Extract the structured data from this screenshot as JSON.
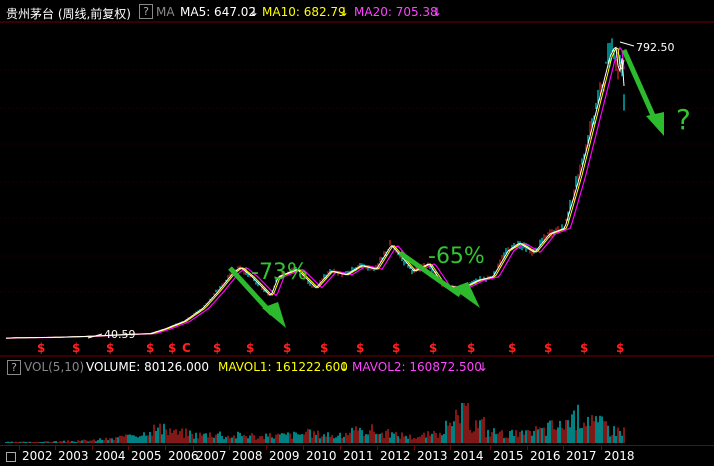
{
  "header": {
    "title": "贵州茅台 (周线,前复权)",
    "help_glyph": "?",
    "ma_label": "MA",
    "ma5": "MA5: 647.02",
    "ma10": "MA10: 682.79",
    "ma20": "MA20: 705.38",
    "arrow_glyph": "↓"
  },
  "annotations": {
    "drop1": "-73%",
    "drop2": "-65%",
    "question": "?",
    "low_price": "40.59",
    "high_price": "792.50"
  },
  "volume_header": {
    "help_glyph": "?",
    "vol_label": "VOL(5,10)",
    "volume": "VOLUME: 80126.000",
    "mavol1": "MAVOL1: 161222.600",
    "mavol2": "MAVOL2: 160872.500",
    "arrow_glyph": "↓"
  },
  "event_markers": [
    "$",
    "$",
    "$",
    "$",
    "$",
    "C",
    "$",
    "$",
    "$",
    "$",
    "$",
    "$",
    "$",
    "$",
    "$",
    "$",
    "$",
    "$"
  ],
  "x_axis": {
    "years": [
      "2002",
      "2003",
      "2004",
      "2005",
      "2006",
      "2007",
      "2008",
      "2009",
      "2010",
      "2011",
      "2012",
      "2013",
      "2014",
      "2015",
      "2016",
      "2017",
      "2018"
    ]
  },
  "colors": {
    "background": "#000000",
    "grid": "#3a0000",
    "ma5": "#ffffff",
    "ma10": "#ffff00",
    "ma20": "#ff00ff",
    "candle_up": "#ff3030",
    "candle_down": "#00ffff",
    "volume_up": "#ff3030",
    "volume_down": "#00ffff",
    "annotation": "#33c433",
    "event_marker": "#ff2020"
  },
  "chart_data": {
    "type": "line",
    "title": "贵州茅台 (周线,前复权)",
    "x": [
      2001.8,
      2002,
      2003,
      2004,
      2005,
      2005.6,
      2006,
      2006.5,
      2007,
      2007.4,
      2007.8,
      2008.0,
      2008.3,
      2008.8,
      2009.0,
      2009.5,
      2010.0,
      2010.4,
      2010.8,
      2011.2,
      2011.6,
      2012.0,
      2012.3,
      2012.6,
      2013.0,
      2013.4,
      2013.9,
      2014.3,
      2014.7,
      2015.1,
      2015.4,
      2015.8,
      2016.2,
      2016.6,
      2017.0,
      2017.4,
      2017.8,
      2017.95,
      2018.05,
      2018.1,
      2018.2
    ],
    "series": [
      {
        "name": "MA5",
        "values": [
          5,
          6,
          7,
          10,
          15,
          17,
          30,
          50,
          85,
          130,
          180,
          195,
          170,
          118,
          170,
          190,
          140,
          185,
          175,
          200,
          190,
          255,
          220,
          185,
          205,
          145,
          140,
          160,
          170,
          240,
          260,
          235,
          285,
          300,
          440,
          600,
          760,
          792.5,
          700,
          780,
          640
        ]
      }
    ],
    "low_label": {
      "year": 2004.2,
      "value": 40.59
    },
    "high_label": {
      "year": 2018.05,
      "value": 792.5
    },
    "volume": [
      3,
      3,
      4,
      5,
      6,
      8,
      12,
      18,
      30,
      45,
      40,
      32,
      26,
      30,
      22,
      25,
      20,
      24,
      26,
      30,
      28,
      22,
      35,
      42,
      30,
      25,
      20,
      26,
      48,
      90,
      60,
      35,
      30,
      28,
      40,
      52,
      70,
      85,
      60,
      40
    ]
  }
}
